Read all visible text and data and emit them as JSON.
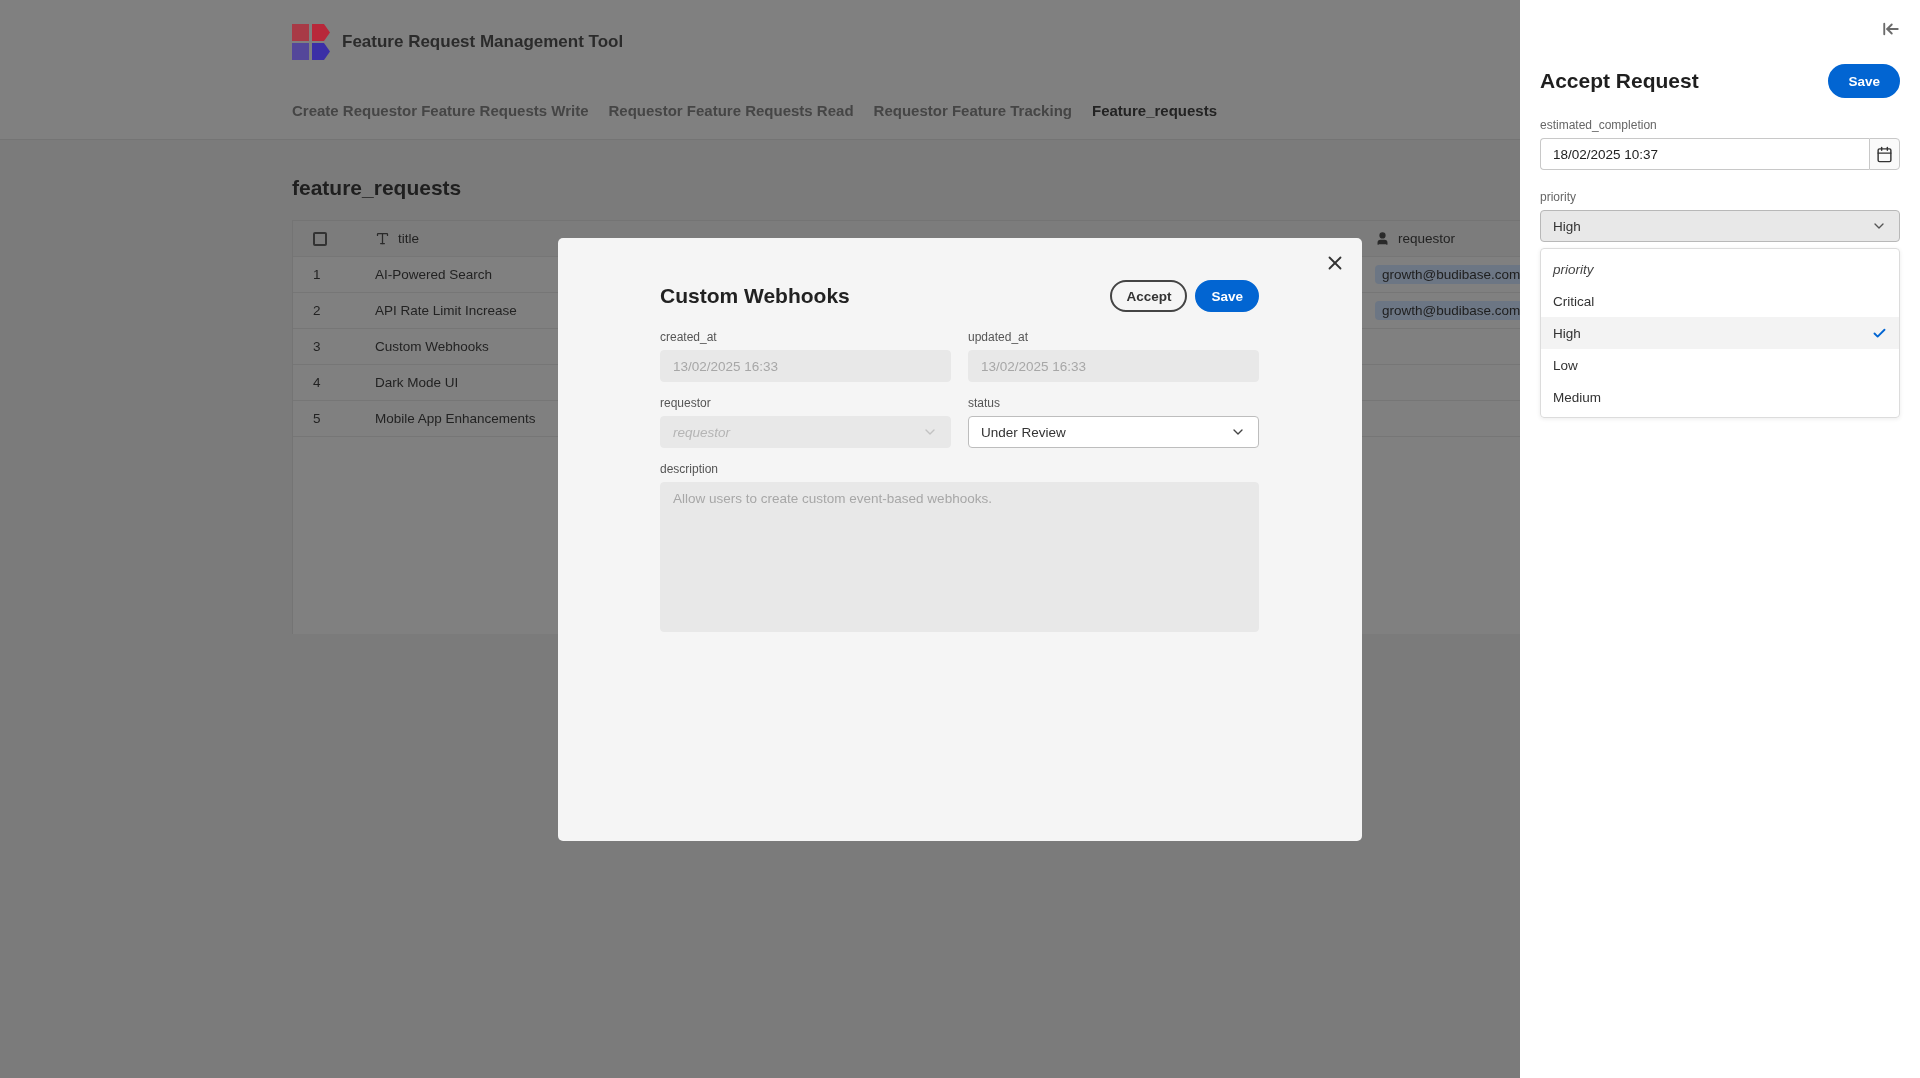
{
  "app": {
    "title": "Feature Request Management Tool"
  },
  "nav": [
    {
      "label": "Create Requestor Feature Requests Write",
      "selected": false
    },
    {
      "label": "Requestor Feature Requests Read",
      "selected": false
    },
    {
      "label": "Requestor Feature Tracking",
      "selected": false
    },
    {
      "label": "Feature_requests",
      "selected": true
    }
  ],
  "page_title": "feature_requests",
  "table": {
    "select_all": {
      "checked": false
    },
    "columns": [
      {
        "label": "title",
        "kind": "text"
      },
      {
        "label": "requestor",
        "kind": "link"
      }
    ],
    "rows": [
      {
        "index": "1",
        "title": "AI-Powered Search",
        "requestor": "growth@budibase.com"
      },
      {
        "index": "2",
        "title": "API Rate Limit Increase",
        "requestor": "growth@budibase.com"
      },
      {
        "index": "3",
        "title": "Custom Webhooks"
      },
      {
        "index": "4",
        "title": "Dark Mode UI"
      },
      {
        "index": "5",
        "title": "Mobile App Enhancements"
      }
    ]
  },
  "modal": {
    "title": "Custom Webhooks",
    "buttons": [
      {
        "label": "Accept",
        "kind": "secondary"
      },
      {
        "label": "Save",
        "kind": "primary"
      }
    ],
    "fields": [
      {
        "label": "created_at",
        "kind": "text",
        "value": "13/02/2025 16:33",
        "disabled": true
      },
      {
        "label": "updated_at",
        "kind": "text",
        "value": "13/02/2025 16:33",
        "disabled": true
      },
      {
        "label": "requestor",
        "kind": "select",
        "placeholder": "requestor",
        "disabled": true
      },
      {
        "label": "status",
        "kind": "select",
        "value": "Under Review",
        "disabled": false
      },
      {
        "label": "description",
        "kind": "textarea",
        "value": "Allow users to create custom event-based webhooks.",
        "disabled": true
      }
    ]
  },
  "side_panel": {
    "title": "Accept Request",
    "save": "Save",
    "date_field": {
      "label": "estimated_completion",
      "value": "18/02/2025 10:37"
    },
    "priority": {
      "label": "priority",
      "value": "High",
      "open": true,
      "options": [
        {
          "label": "priority",
          "kind": "placeholder",
          "selected": false
        },
        {
          "label": "Critical",
          "kind": "option",
          "selected": false
        },
        {
          "label": "High",
          "kind": "option",
          "selected": true
        },
        {
          "label": "Low",
          "kind": "option",
          "selected": false
        },
        {
          "label": "Medium",
          "kind": "option",
          "selected": false
        }
      ]
    }
  }
}
